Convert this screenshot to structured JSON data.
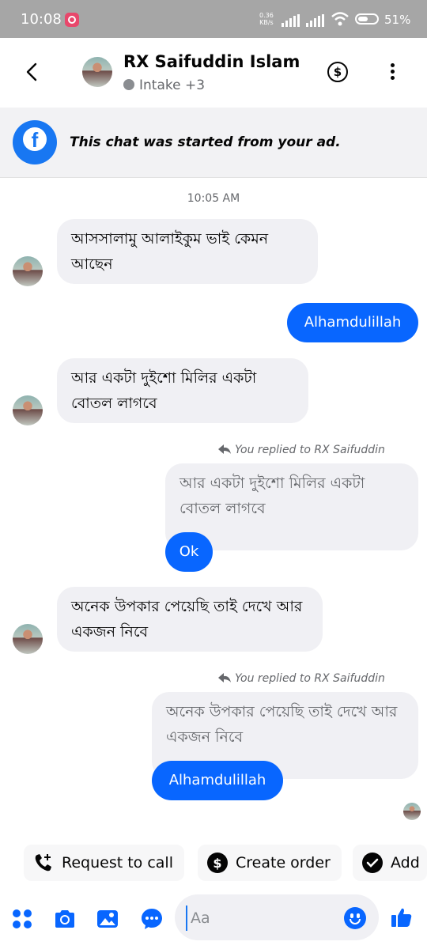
{
  "status_bar": {
    "time": "10:08",
    "net_speed_value": "0.36",
    "net_speed_unit": "KB/s",
    "battery_percent": "51%"
  },
  "header": {
    "back_icon": "chevron-left-icon",
    "contact_name": "RX Saifuddin Islam",
    "subtitle": "Intake +3",
    "payment_icon": "dollar-circle-icon",
    "more_icon": "more-vertical-icon"
  },
  "banner": {
    "icon": "facebook-icon",
    "text": "This chat was started from your ad."
  },
  "conversation": {
    "timestamp": "10:05 AM",
    "messages": [
      {
        "direction": "incoming",
        "text": "আসসালামু আলাইকুম ভাই কেমন আছেন"
      },
      {
        "direction": "outgoing",
        "text": "Alhamdulillah"
      },
      {
        "direction": "incoming",
        "text": "আর একটা দুইশো মিলির একটা বোতল লাগবে"
      },
      {
        "direction": "outgoing",
        "reply_note": "You replied to RX Saifuddin",
        "quoted": "আর একটা দুইশো মিলির একটা বোতল লাগবে",
        "text": "Ok"
      },
      {
        "direction": "incoming",
        "text": "অনেক উপকার পেয়েছি তাই দেখে আর একজন নিবে"
      },
      {
        "direction": "outgoing",
        "reply_note": "You replied to RX Saifuddin",
        "quoted": "অনেক উপকার পেয়েছি তাই দেখে আর একজন নিবে",
        "text": "Alhamdulillah"
      }
    ]
  },
  "quick_actions": [
    {
      "label": "Request to call",
      "icon": "phone-plus-icon"
    },
    {
      "label": "Create order",
      "icon": "dollar-circle-icon"
    },
    {
      "label": "Add",
      "icon": "checkmark-circle-icon"
    }
  ],
  "composer": {
    "placeholder": "Aa",
    "icons": [
      "apps-grid-icon",
      "camera-icon",
      "gallery-icon",
      "chat-bubble-icon",
      "emoji-icon",
      "thumbs-up-icon"
    ]
  },
  "colors": {
    "accent": "#0866ff",
    "incoming_bubble": "#f0f0f4",
    "status_bar": "#a6a6a6"
  }
}
